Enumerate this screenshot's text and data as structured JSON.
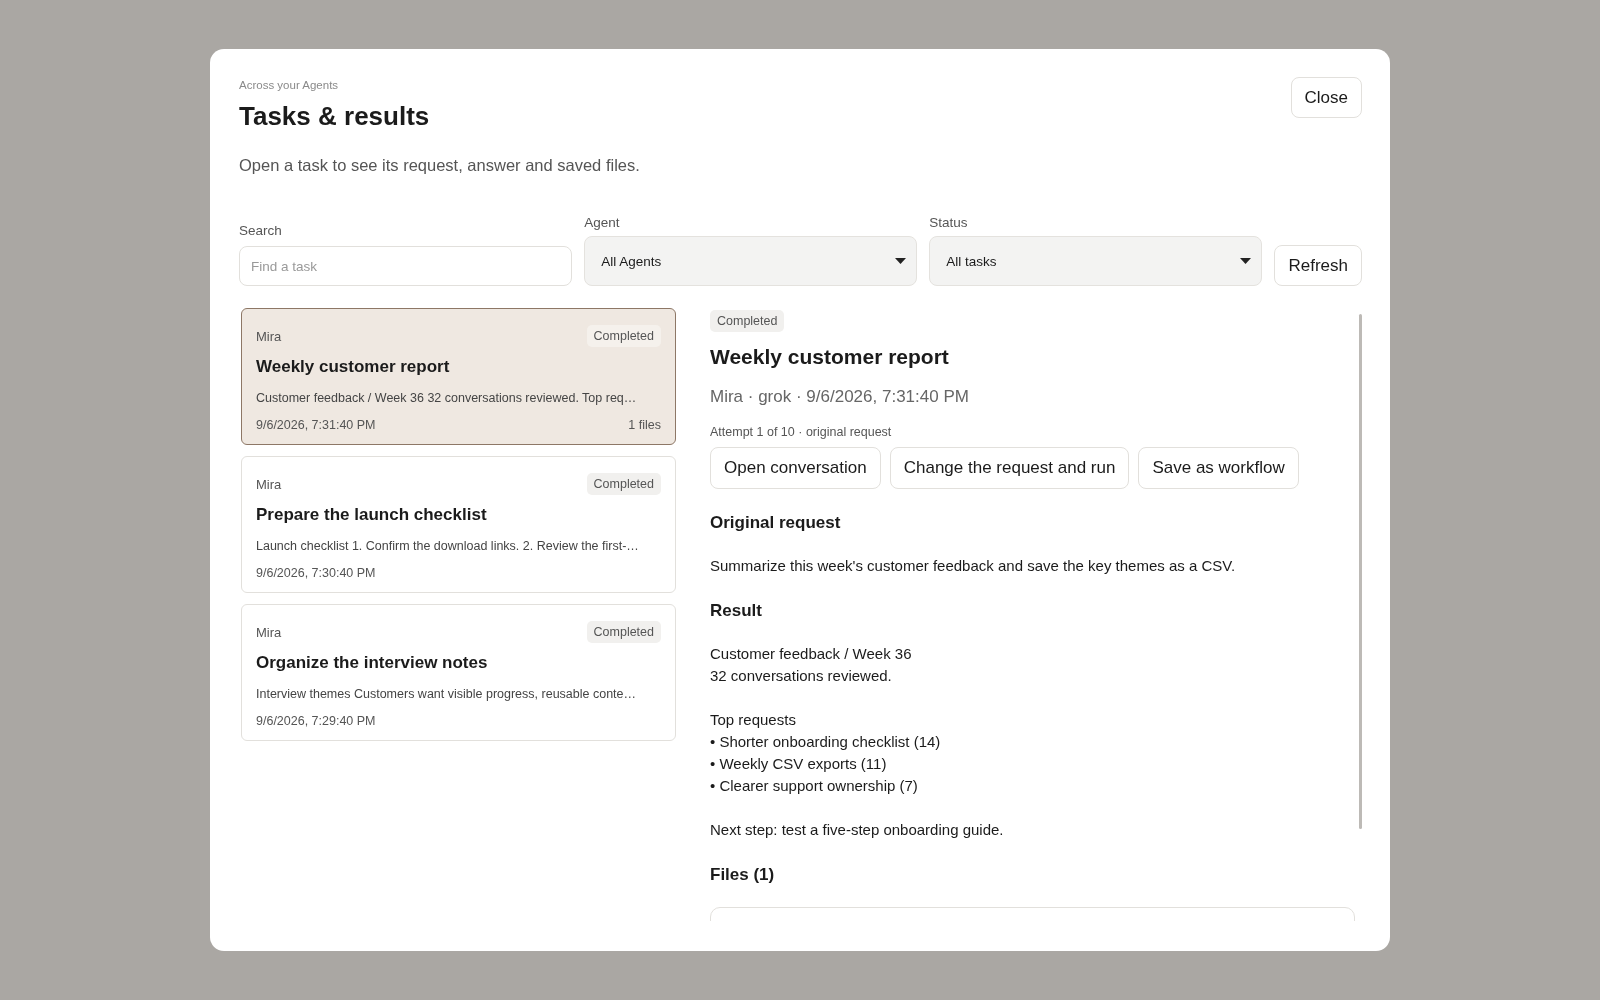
{
  "dialog": {
    "eyebrow": "Across your Agents",
    "title": "Tasks & results",
    "subtitle": "Open a task to see its request, answer and saved files.",
    "close": "Close"
  },
  "filters": {
    "search": {
      "label": "Search",
      "placeholder": "Find a task"
    },
    "agent": {
      "label": "Agent",
      "value": "All Agents"
    },
    "status": {
      "label": "Status",
      "value": "All tasks"
    },
    "refresh": "Refresh"
  },
  "tasks": [
    {
      "agent": "Mira",
      "status": "Completed",
      "title": "Weekly customer report",
      "preview": "Customer feedback / Week 36 32 conversations reviewed. Top req…",
      "time": "9/6/2026, 7:31:40 PM",
      "files": "1 files",
      "selected": true
    },
    {
      "agent": "Mira",
      "status": "Completed",
      "title": "Prepare the launch checklist",
      "preview": "Launch checklist 1. Confirm the download links. 2. Review the first-…",
      "time": "9/6/2026, 7:30:40 PM",
      "selected": false
    },
    {
      "agent": "Mira",
      "status": "Completed",
      "title": "Organize the interview notes",
      "preview": "Interview themes Customers want visible progress, reusable conte…",
      "time": "9/6/2026, 7:29:40 PM",
      "selected": false
    }
  ],
  "detail": {
    "status": "Completed",
    "title": "Weekly customer report",
    "meta": "Mira · grok · 9/6/2026, 7:31:40 PM",
    "attempt": "Attempt 1 of 10 · original request",
    "actions": [
      "Open conversation",
      "Change the request and run",
      "Save as workflow"
    ],
    "request_heading": "Original request",
    "request": "Summarize this week's customer feedback and save the key themes as a CSV.",
    "result_heading": "Result",
    "result": [
      [
        "Customer feedback / Week 36",
        "32 conversations reviewed."
      ],
      [
        "Top requests",
        "• Shorter onboarding checklist (14)",
        "• Weekly CSV exports (11)",
        "• Clearer support ownership (7)"
      ],
      [
        "Next step: test a five-step onboarding guide."
      ]
    ],
    "files_heading": "Files (1)"
  }
}
